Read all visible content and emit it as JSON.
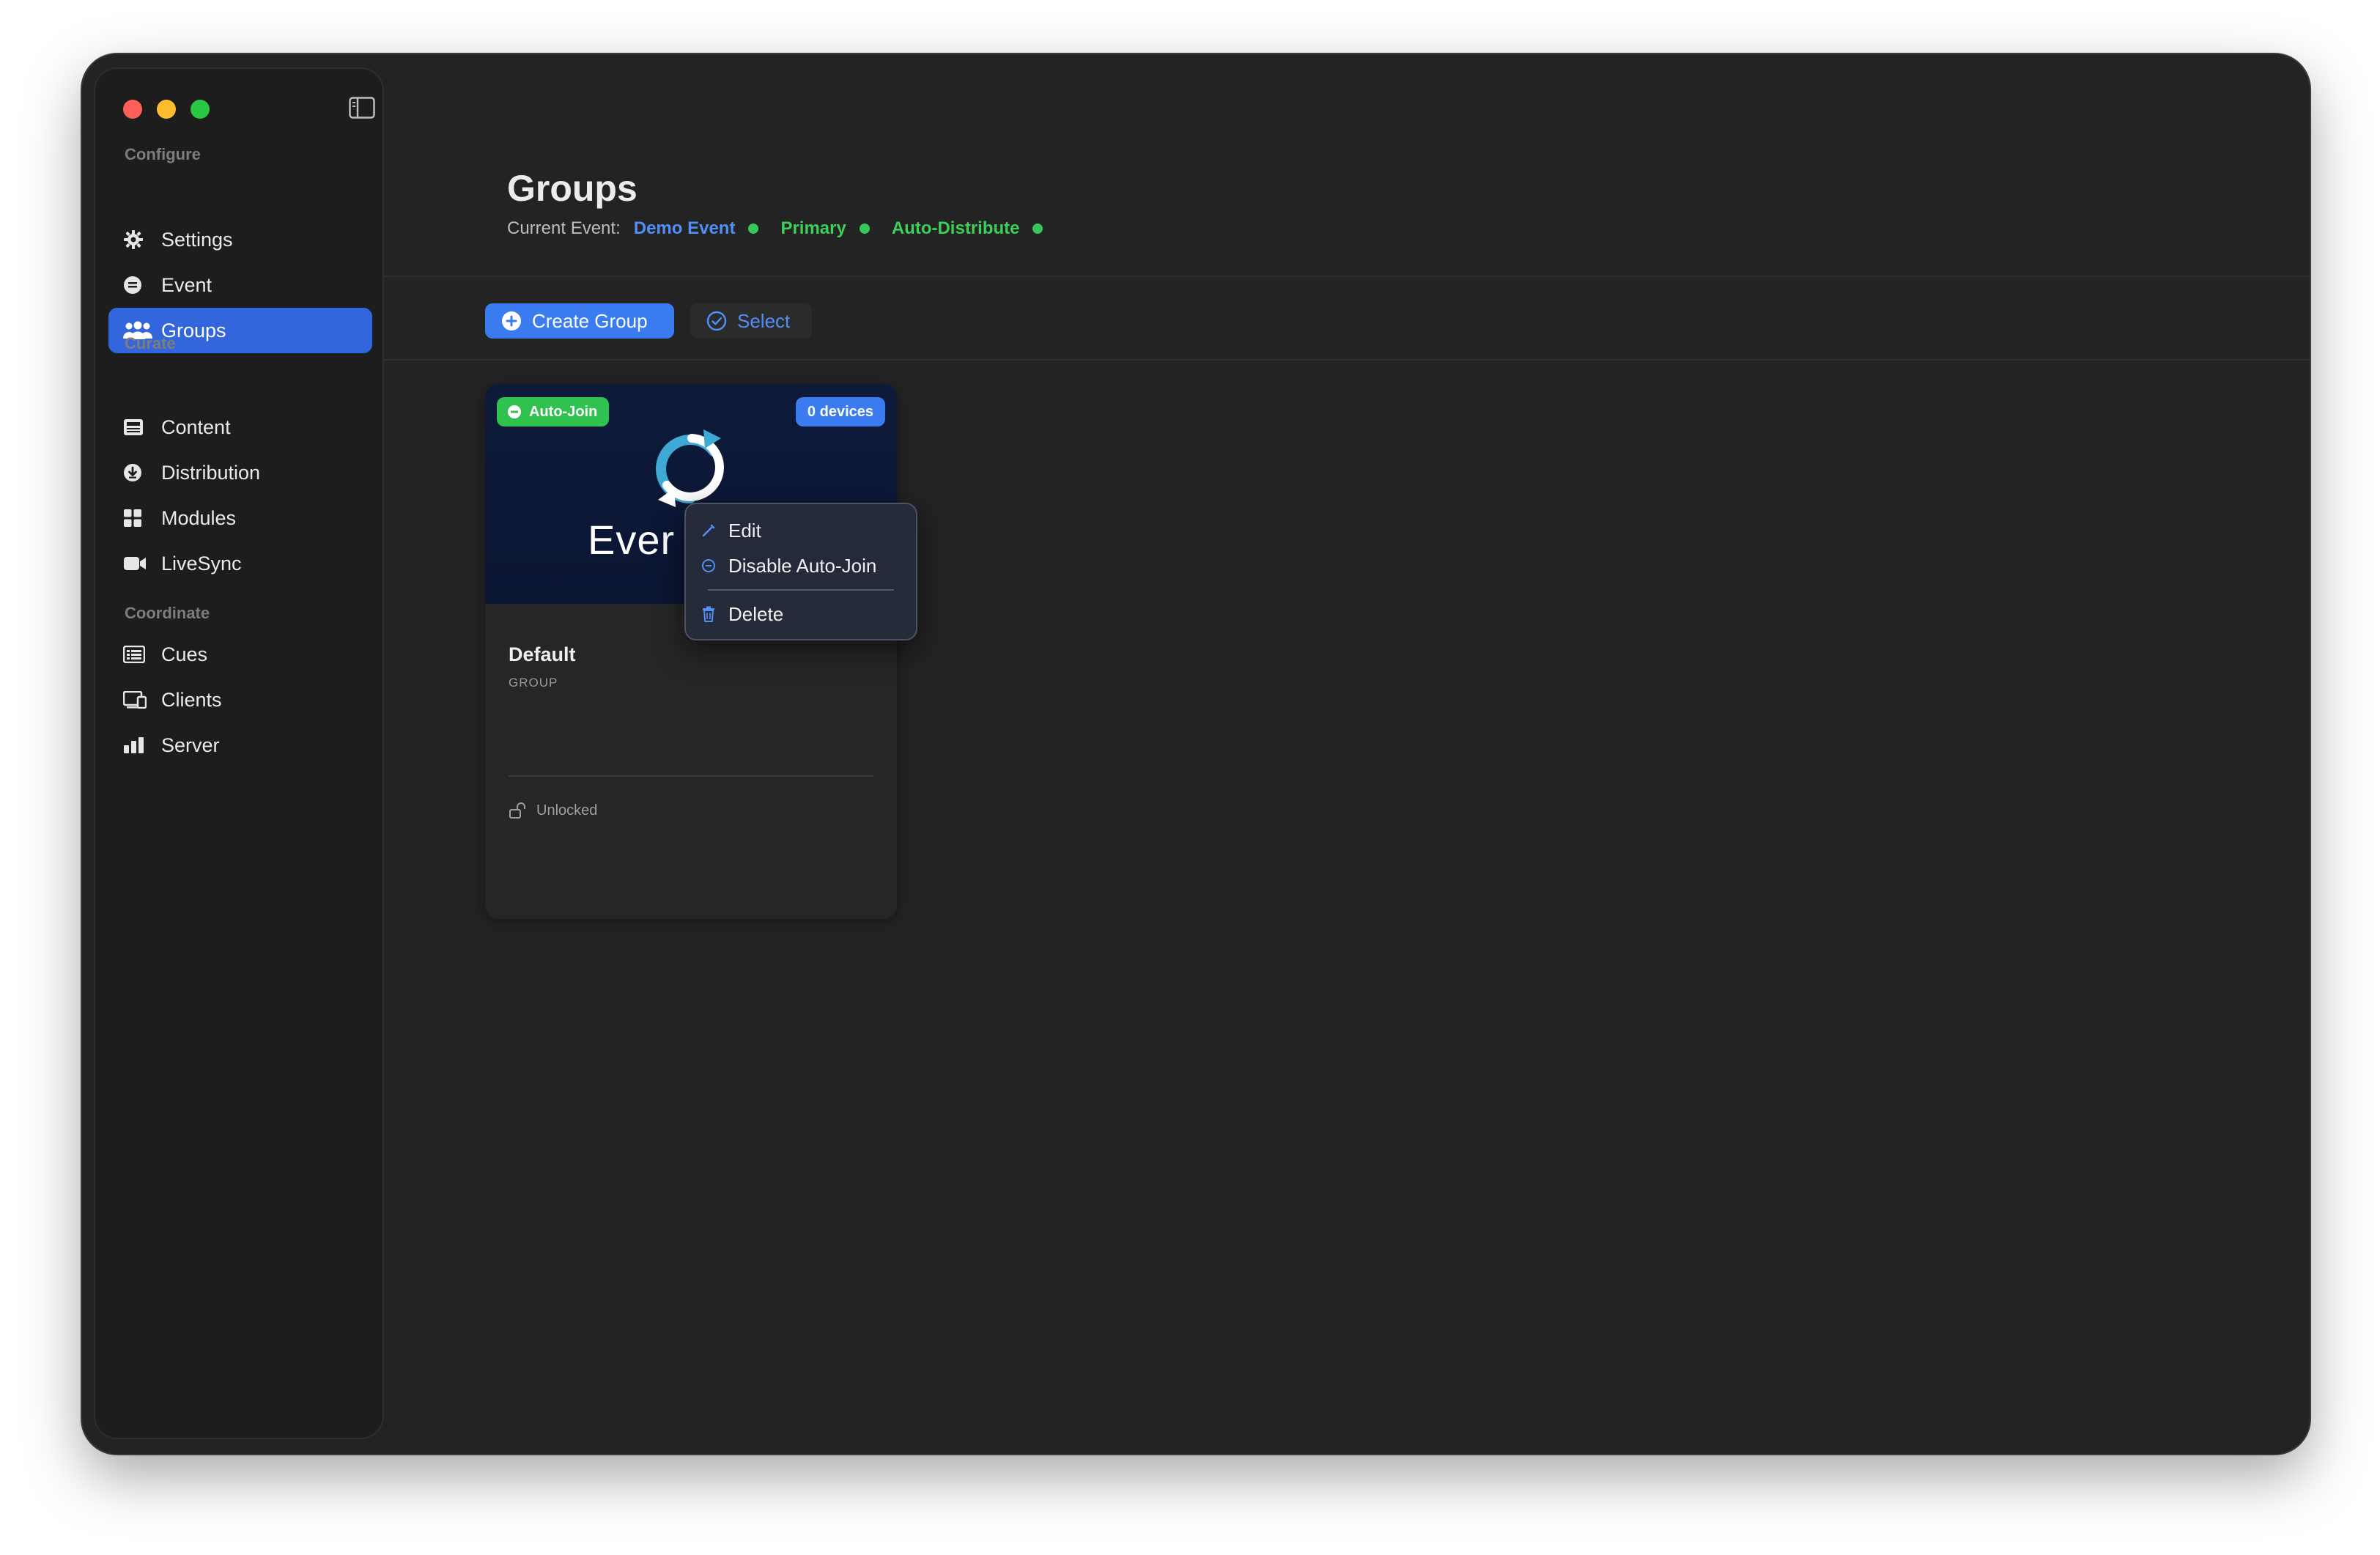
{
  "sidebar": {
    "sections": [
      {
        "title": "Configure",
        "items": [
          "Settings",
          "Event",
          "Groups"
        ]
      },
      {
        "title": "Curate",
        "items": [
          "Content",
          "Distribution",
          "Modules",
          "LiveSync"
        ]
      },
      {
        "title": "Coordinate",
        "items": [
          "Cues",
          "Clients",
          "Server"
        ]
      }
    ],
    "active_item": "Groups"
  },
  "header": {
    "title": "Groups",
    "current_event_label": "Current Event:",
    "current_event_name": "Demo Event",
    "status_primary": "Primary",
    "status_auto_distribute": "Auto-Distribute"
  },
  "toolbar": {
    "create_label": "Create Group",
    "select_label": "Select"
  },
  "card": {
    "auto_join_badge": "Auto-Join",
    "devices_badge": "0 devices",
    "thumbnail_text": "Ever",
    "name": "Default",
    "kind": "GROUP",
    "lock_status": "Unlocked"
  },
  "context_menu": {
    "edit": "Edit",
    "disable_auto_join": "Disable Auto-Join",
    "delete": "Delete"
  },
  "colors": {
    "accent": "#3a7cf0",
    "active_nav": "#3366dd",
    "success": "#34c759",
    "link": "#4f8ff7"
  }
}
